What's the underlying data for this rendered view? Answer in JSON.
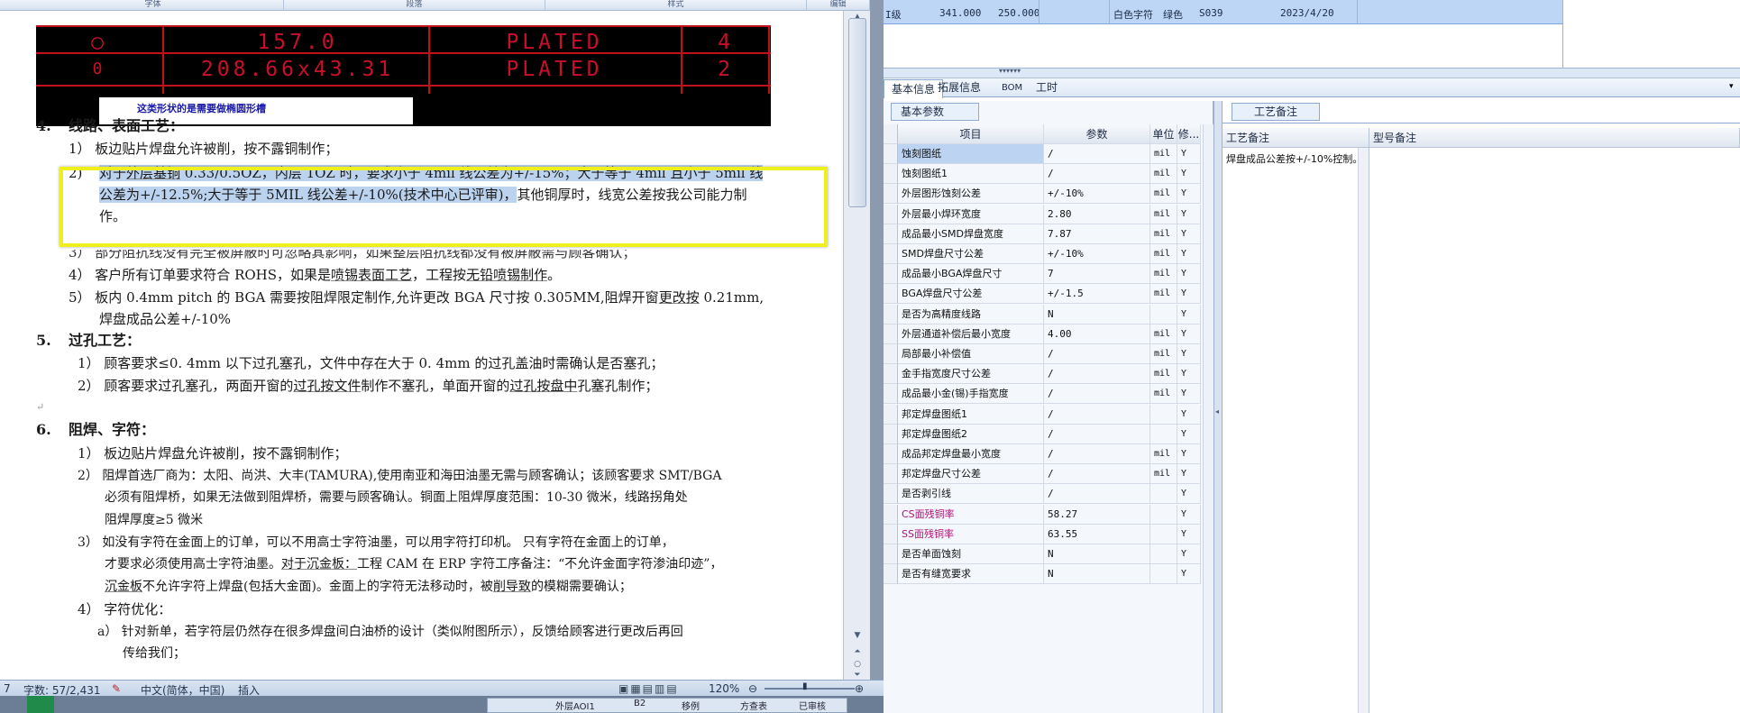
{
  "word": {
    "ribbon_groups": [
      "字体",
      "段落",
      "样式",
      "编辑"
    ],
    "cad": {
      "row1": [
        "157.0",
        "PLATED",
        "4"
      ],
      "row2": [
        "208.66x43.31",
        "PLATED",
        "2"
      ],
      "symbol1": "○",
      "symbol2": "0",
      "note": "这类形状的是需要做椭圆形槽"
    },
    "lines": {
      "s4_num": "4.",
      "s4_title": "线路、表面工艺：",
      "s4_1": "1） 板边贴片焊盘允许被削，按不露铜制作；",
      "s4_2_num": "2)",
      "s4_2_a1": "对于",
      "s4_2_a2": "外层基铜",
      "s4_2_a3": " 0.33/0.5OZ，内层 1OZ 时，要求小于 4mil 线公差为+/-15%；大于等于 4mil 且小于 5mil 线",
      "s4_2_b": "公差为+/-12.5%;大于等于 5MIL 线公差+/-10%(技术中心已评审)，",
      "s4_2_b2": "其他铜厚时，线宽公差按我公司能力制",
      "s4_2_c": "作。",
      "s4_3": "3） 部分阻抗线没有完全被屏蔽时可忽略其影响，如果整层阻抗线都没有被屏蔽需与顾客确认；",
      "s4_4a": "4） 客户所有订单要求符合 ROHS，如果是",
      "s4_4b": "喷锡表面工艺",
      "s4_4c": "，工程按",
      "s4_4d": "无铅喷锡制作",
      "s4_4e": "。",
      "s4_5a": "5） 板内 0.4mm pitch 的 BGA 需要按阻焊限定制作,允许更改 BGA 尺寸按 0.305MM,阻焊开窗",
      "s4_5b": "更改按",
      "s4_5c": " 0.21mm,",
      "s4_5d": "焊盘成品公差+/-10%",
      "s5_num": "5.",
      "s5_title": "过孔工艺：",
      "s5_1": "1） 顾客要求≤0. 4mm 以下过孔塞孔，文件中存在大于 0. 4mm 的过孔盖油时需确认是否塞孔；",
      "s5_2a": "2） 顾客要求过孔塞孔，两面开窗的",
      "s5_2b": "过孔按文件",
      "s5_2c": "制作不塞孔，单面开窗的",
      "s5_2d": "过孔按盘中",
      "s5_2e": "孔塞孔制作；",
      "s6_num": "6.",
      "s6_title": "阻焊、字符：",
      "s6_1": "1） 板边贴片焊盘允许被削，按不露铜制作；",
      "s6_2a": "2） 阻焊首选厂商为：太阳、尚洪、大丰(TAMURA),使用南亚和海田油墨无需与顾客确认；该顾客要求 SMT/BGA",
      "s6_2b": "必须有阻焊桥，如果无法做到阻焊桥，需要与顾客确认。铜面上阻焊厚度范围：10-30 微米，线路拐角处",
      "s6_2c": "阻焊厚度≥5 微米",
      "s6_3a": "3） 如没有字符在金面上的订单，可以不用高士字符油墨，可以用字符打印机。    只有字符在金面上的订单，",
      "s6_3b1": "才要求必须使用高士字符油墨。",
      "s6_3b2": "对于沉金板：",
      "s6_3b3": "工程 CAM 在 ERP 字符工序备注：“不允许金面字符渗油印迹”，",
      "s6_3c1": "沉金板",
      "s6_3c2": "不允许字符上焊盘(包括大金面)。金面上的字符无法移动时，被",
      "s6_3c3": "削导致",
      "s6_3c4": "的模糊需要确认；",
      "s6_4": "4） 字符优化：",
      "s6_4a1": "a） 针对新单，若字符层仍然存在很多焊盘间白油桥的设计（类似附图所示），反馈给顾客进行更改后再回",
      "s6_4a2": "传给我们；"
    },
    "para_mark": "↵",
    "status": {
      "page": "7",
      "words": "字数: 57/2,431",
      "lang": "中文(简体，中国)",
      "mode": "插入",
      "zoom": "120%"
    },
    "taskbar": [
      "外层AOI1",
      "B2",
      "移例",
      "方查表",
      "已审核"
    ]
  },
  "erp": {
    "top_row": [
      "I级",
      "341.000",
      "250.000",
      "白色字符",
      "绿色",
      "S039",
      "2023/4/20"
    ],
    "tabs": [
      "基本信息",
      "拓展信息",
      "BOM",
      "工时"
    ],
    "left_subtab": "基本参数",
    "right_subtab": "工艺备注",
    "grid_headers": [
      "项目",
      "参数",
      "单位",
      "修..."
    ],
    "rows": [
      {
        "item": "蚀刻图纸",
        "param": "/",
        "unit": "mil",
        "mod": "Y",
        "selected": true
      },
      {
        "item": "蚀刻图纸1",
        "param": "/",
        "unit": "mil",
        "mod": "Y"
      },
      {
        "item": "外层图形蚀刻公差",
        "param": "+/-10%",
        "unit": "mil",
        "mod": "Y"
      },
      {
        "item": "外层最小焊环宽度",
        "param": "2.80",
        "unit": "mil",
        "mod": "Y"
      },
      {
        "item": "成品最小SMD焊盘宽度",
        "param": "7.87",
        "unit": "mil",
        "mod": "Y"
      },
      {
        "item": "SMD焊盘尺寸公差",
        "param": "+/-10%",
        "unit": "mil",
        "mod": "Y"
      },
      {
        "item": "成品最小BGA焊盘尺寸",
        "param": "7",
        "unit": "mil",
        "mod": "Y"
      },
      {
        "item": "BGA焊盘尺寸公差",
        "param": "+/-1.5",
        "unit": "mil",
        "mod": "Y"
      },
      {
        "item": "是否为高精度线路",
        "param": "N",
        "unit": "",
        "mod": "Y"
      },
      {
        "item": "外层通道补偿后最小宽度",
        "param": "4.00",
        "unit": "mil",
        "mod": "Y"
      },
      {
        "item": "局部最小补偿值",
        "param": "/",
        "unit": "mil",
        "mod": "Y"
      },
      {
        "item": "金手指宽度尺寸公差",
        "param": "/",
        "unit": "mil",
        "mod": "Y"
      },
      {
        "item": "成品最小金(锡)手指宽度",
        "param": "/",
        "unit": "mil",
        "mod": "Y"
      },
      {
        "item": "邦定焊盘图纸1",
        "param": "/",
        "unit": "",
        "mod": "Y"
      },
      {
        "item": "邦定焊盘图纸2",
        "param": "/",
        "unit": "",
        "mod": "Y"
      },
      {
        "item": "成品邦定焊盘最小宽度",
        "param": "/",
        "unit": "mil",
        "mod": "Y"
      },
      {
        "item": "邦定焊盘尺寸公差",
        "param": "/",
        "unit": "mil",
        "mod": "Y"
      },
      {
        "item": "是否剥引线",
        "param": "/",
        "unit": "",
        "mod": "Y"
      },
      {
        "item": "CS面残铜率",
        "param": "58.27",
        "unit": "",
        "mod": "Y",
        "pink": true
      },
      {
        "item": "SS面残铜率",
        "param": "63.55",
        "unit": "",
        "mod": "Y",
        "pink": true
      },
      {
        "item": "是否单面蚀刻",
        "param": "N",
        "unit": "",
        "mod": "Y"
      },
      {
        "item": "是否有缝宽要求",
        "param": "N",
        "unit": "",
        "mod": "Y"
      }
    ],
    "remark_headers": [
      "工艺备注",
      "型号备注"
    ],
    "remark_text": "焊盘成品公差按+/-10%控制。"
  }
}
